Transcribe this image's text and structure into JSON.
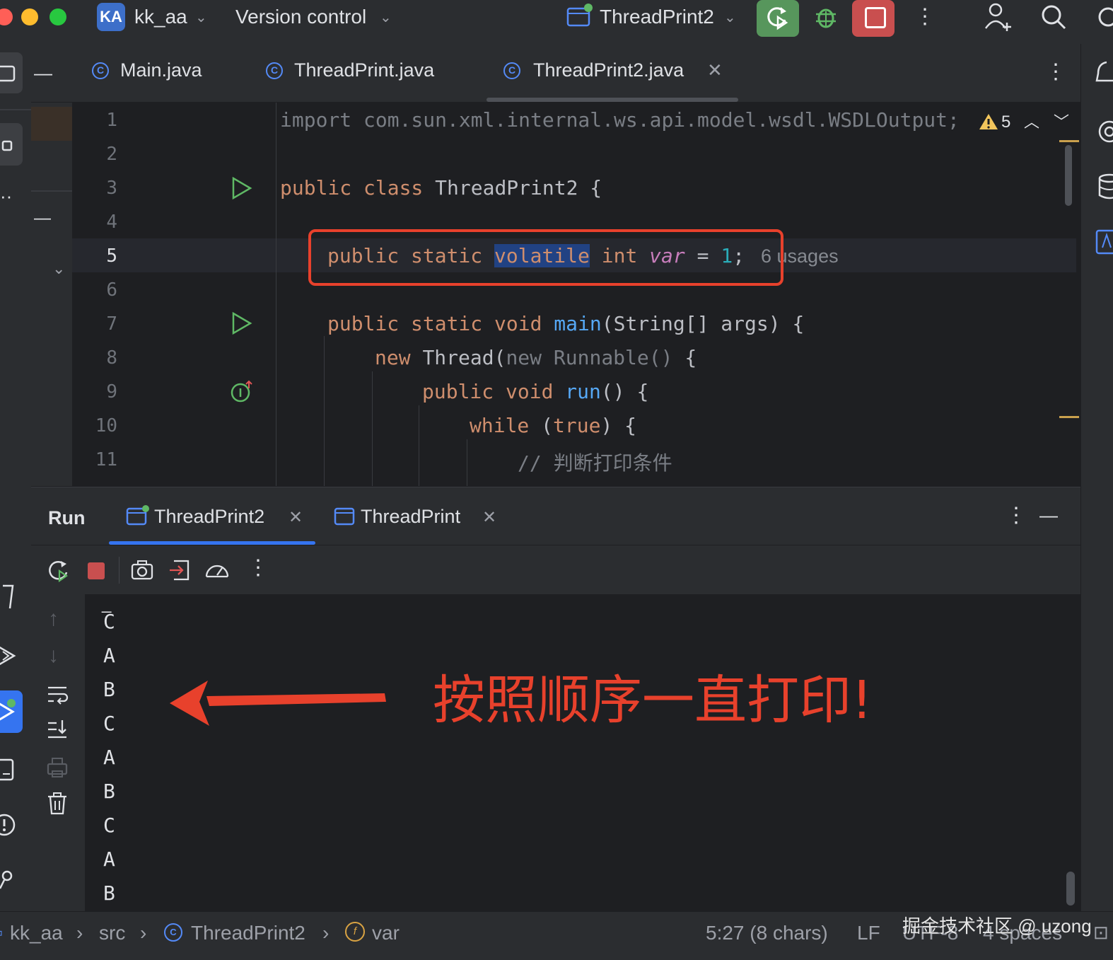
{
  "titlebar": {
    "project_badge": "KA",
    "project_name": "kk_aa",
    "vcs_menu": "Version control",
    "run_config": "ThreadPrint2"
  },
  "editor_tabs": [
    {
      "label": "Main.java"
    },
    {
      "label": "ThreadPrint.java"
    },
    {
      "label": "ThreadPrint2.java",
      "active": true
    }
  ],
  "editor": {
    "line_numbers": [
      "1",
      "2",
      "3",
      "4",
      "5",
      "6",
      "7",
      "8",
      "9",
      "10",
      "11"
    ],
    "warnings_count": "5",
    "line1": "import com.sun.xml.internal.ws.api.model.wsdl.WSDLOutput;",
    "line3_kw": "public class ",
    "line3_rest": "ThreadPrint2 {",
    "line5_kw1": "public static ",
    "line5_sel": "volatile",
    "line5_kw2": " int ",
    "line5_var": "var",
    "line5_eq": " = ",
    "line5_num": "1",
    "line5_semi": ";",
    "line5_hint": "6 usages",
    "line7_kw": "public static void ",
    "line7_fn": "main",
    "line7_rest": "(String[] args) {",
    "line8_kw": "new ",
    "line8_mid": "Thread(",
    "line8_gray": "new Runnable()",
    "line8_rest": " {",
    "line9_kw": "public void ",
    "line9_fn": "run",
    "line9_rest": "() {",
    "line10_kw": "while ",
    "line10_p1": "(",
    "line10_true": "true",
    "line10_rest": ") {",
    "line11": "// 判断打印条件",
    "highlight_color": "#e8412c"
  },
  "run_panel": {
    "title": "Run",
    "tabs": [
      {
        "label": "ThreadPrint2",
        "active": true
      },
      {
        "label": "ThreadPrint"
      }
    ],
    "output_lines": [
      "C",
      "A",
      "B",
      "C",
      "A",
      "B",
      "C",
      "A",
      "B"
    ],
    "annotation": "按照顺序一直打印!"
  },
  "statusbar": {
    "breadcrumbs": [
      "kk_aa",
      "src",
      "ThreadPrint2",
      "var"
    ],
    "position": "5:27 (8 chars)",
    "line_sep": "LF",
    "encoding": "UTF-8",
    "indent": "4 spaces",
    "watermark": "掘金技术社区 @ uzong"
  }
}
